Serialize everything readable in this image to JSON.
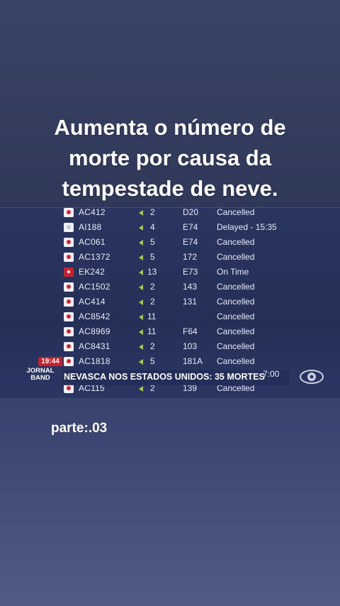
{
  "caption": {
    "line1": "Aumenta o número de",
    "line2": "morte por causa da",
    "line3": "tempestade de neve."
  },
  "flights": [
    {
      "flight": "AC412",
      "gate": "2",
      "term": "D20",
      "status": "Cancelled",
      "logo": "air-canada"
    },
    {
      "flight": "AI188",
      "gate": "4",
      "term": "E74",
      "status": "Delayed  - 15:35",
      "logo": "air-india"
    },
    {
      "flight": "AC061",
      "gate": "5",
      "term": "E74",
      "status": "Cancelled",
      "logo": "air-canada"
    },
    {
      "flight": "AC1372",
      "gate": "5",
      "term": "172",
      "status": "Cancelled",
      "logo": "air-canada"
    },
    {
      "flight": "EK242",
      "gate": "13",
      "term": "E73",
      "status": "On Time",
      "logo": "emirates"
    },
    {
      "flight": "AC1502",
      "gate": "2",
      "term": "143",
      "status": "Cancelled",
      "logo": "air-canada"
    },
    {
      "flight": "AC414",
      "gate": "2",
      "term": "131",
      "status": "Cancelled",
      "logo": "air-canada"
    },
    {
      "flight": "AC8542",
      "gate": "11",
      "term": "",
      "status": "Cancelled",
      "logo": "air-canada"
    },
    {
      "flight": "AC8969",
      "gate": "11",
      "term": "F64",
      "status": "Cancelled",
      "logo": "air-canada"
    },
    {
      "flight": "AC8431",
      "gate": "2",
      "term": "103",
      "status": "Cancelled",
      "logo": "air-canada"
    },
    {
      "flight": "AC1818",
      "gate": "5",
      "term": "181A",
      "status": "Cancelled",
      "logo": "air-canada"
    },
    {
      "flight": "AC115",
      "gate": "2",
      "term": "139",
      "status": "Cancelled",
      "logo": "air-canada"
    }
  ],
  "broadcast": {
    "time": "19:44",
    "brand_top": "JORNAL",
    "brand_bottom": "BAND",
    "headline": "NEVASCA NOS ESTADOS UNIDOS: 35 MORTES",
    "partial_time": "7:00",
    "channel_logo": "band-eye-logo"
  },
  "footer": {
    "part_label": "parte:.03"
  },
  "colors": {
    "background": "#343e63",
    "status_arrow": "#a7cc3c",
    "clock_bg": "#c81f2b"
  }
}
